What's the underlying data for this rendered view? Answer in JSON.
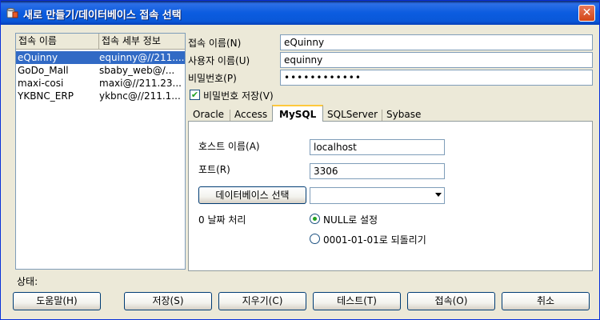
{
  "window": {
    "title": "새로 만들기/데이터베이스 접속 선택",
    "close_label": "✕"
  },
  "connections": {
    "headers": [
      "접속 이름",
      "접속 세부 정보"
    ],
    "rows": [
      {
        "name": "eQuinny",
        "detail": "equinny@//211...."
      },
      {
        "name": "GoDo_Mall",
        "detail": "sbaby_web@/..."
      },
      {
        "name": "maxi-cosi",
        "detail": "maxi@//211.23..."
      },
      {
        "name": "YKBNC_ERP",
        "detail": "ykbnc@//211.1..."
      }
    ],
    "selected_index": 0
  },
  "form": {
    "conn_name_label": "접속 이름(N)",
    "conn_name_value": "eQuinny",
    "user_label": "사용자 이름(U)",
    "user_value": "equinny",
    "password_label": "비밀번호(P)",
    "password_value": "••••••••••••",
    "save_password_label": "비밀번호 저장(V)",
    "save_password_checked": true
  },
  "tabs": [
    "Oracle",
    "Access",
    "MySQL",
    "SQLServer",
    "Sybase"
  ],
  "active_tab": "MySQL",
  "mysql": {
    "host_label": "호스트 이름(A)",
    "host_value": "localhost",
    "port_label": "포트(R)",
    "port_value": "3306",
    "select_db_button": "데이터베이스 선택",
    "db_combo_value": "",
    "zero_date_label": "0 날짜 처리",
    "zero_date_options": [
      "NULL로 설정",
      "0001-01-01로 되돌리기"
    ],
    "zero_date_selected": 0
  },
  "status": {
    "label": "상태:",
    "text": ""
  },
  "buttons": {
    "help": "도움말(H)",
    "save": "저장(S)",
    "clear": "지우기(C)",
    "test": "테스트(T)",
    "connect": "접속(O)",
    "cancel": "취소"
  }
}
